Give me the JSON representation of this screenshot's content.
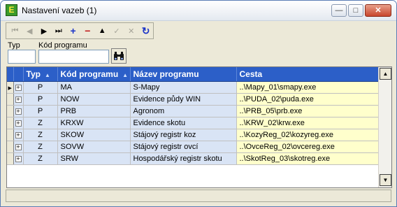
{
  "window": {
    "title": "Nastavení vazeb (1)",
    "app_icon_letter": "E",
    "min_glyph": "—",
    "max_glyph": "□",
    "close_glyph": "✕"
  },
  "navigator": {
    "buttons": [
      {
        "name": "first-record-icon",
        "glyph": "⏮",
        "enabled": false
      },
      {
        "name": "prior-record-icon",
        "glyph": "◀",
        "enabled": false
      },
      {
        "name": "next-record-icon",
        "glyph": "▶",
        "enabled": true
      },
      {
        "name": "last-record-icon",
        "glyph": "⏭",
        "enabled": true
      },
      {
        "name": "insert-record-icon",
        "glyph": "+",
        "enabled": true
      },
      {
        "name": "delete-record-icon",
        "glyph": "−",
        "enabled": true
      },
      {
        "name": "edit-record-icon",
        "glyph": "▲",
        "enabled": true
      },
      {
        "name": "post-record-icon",
        "glyph": "✓",
        "enabled": false
      },
      {
        "name": "cancel-record-icon",
        "glyph": "✕",
        "enabled": false
      },
      {
        "name": "refresh-icon",
        "glyph": "↻",
        "enabled": true
      }
    ]
  },
  "filter": {
    "typ_label": "Typ",
    "typ_value": "",
    "kod_label": "Kód programu",
    "kod_value": ""
  },
  "grid": {
    "columns": [
      "Typ",
      "Kód programu",
      "Název programu",
      "Cesta"
    ],
    "sorted_columns": [
      0,
      1
    ],
    "rows": [
      {
        "typ": "P",
        "kod": "MA",
        "nazev": "S-Mapy",
        "cesta": "..\\Mapy_01\\smapy.exe",
        "current": true
      },
      {
        "typ": "P",
        "kod": "NOW",
        "nazev": "Evidence půdy WIN",
        "cesta": "..\\PUDA_02\\puda.exe",
        "current": false
      },
      {
        "typ": "P",
        "kod": "PRB",
        "nazev": "Agronom",
        "cesta": "..\\PRB_05\\prb.exe",
        "current": false
      },
      {
        "typ": "Z",
        "kod": "KRXW",
        "nazev": "Evidence skotu",
        "cesta": "..\\KRW_02\\krw.exe",
        "current": false
      },
      {
        "typ": "Z",
        "kod": "SKOW",
        "nazev": "Stájový registr koz",
        "cesta": "..\\KozyReg_02\\kozyreg.exe",
        "current": false
      },
      {
        "typ": "Z",
        "kod": "SOVW",
        "nazev": "Stájový registr ovcí",
        "cesta": "..\\OvceReg_02\\ovcereg.exe",
        "current": false
      },
      {
        "typ": "Z",
        "kod": "SRW",
        "nazev": "Hospodářský registr skotu",
        "cesta": "..\\SkotReg_03\\skotreg.exe",
        "current": false
      }
    ]
  },
  "colors": {
    "header": "#2c5fc8",
    "data_cell": "#d9e4f5",
    "path_cell": "#ffffcc",
    "window_face": "#ece9d8"
  }
}
